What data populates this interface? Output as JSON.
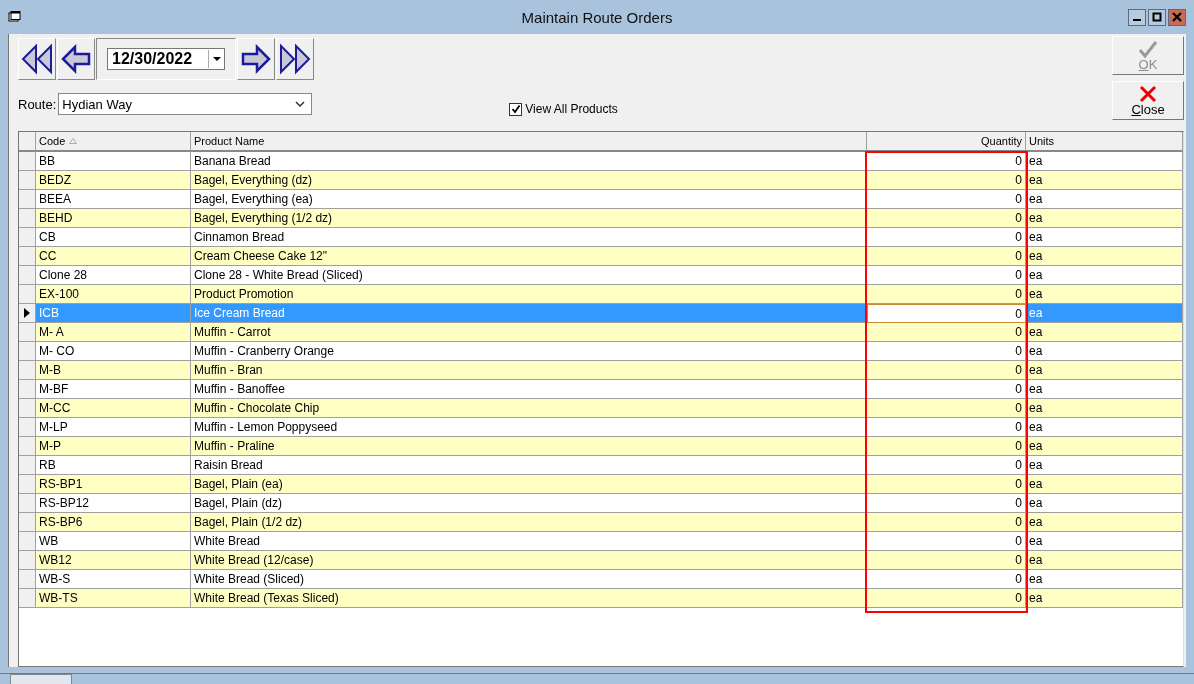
{
  "window": {
    "title": "Maintain Route Orders"
  },
  "date": {
    "value": "12/30/2022"
  },
  "route": {
    "label": "Route:",
    "value": "Hydian Way"
  },
  "view_all": {
    "label": "View All Products",
    "checked": true
  },
  "buttons": [
    {
      "kind": "ok",
      "label": "OK",
      "disabled": true
    },
    {
      "kind": "close",
      "label": "Close",
      "disabled": false
    }
  ],
  "table": {
    "columns": [
      {
        "label": "Code",
        "sorted": true
      },
      {
        "label": "Product Name",
        "sorted": false
      },
      {
        "label": "Quantity",
        "sorted": false
      },
      {
        "label": "Units",
        "sorted": false
      }
    ],
    "rows": [
      {
        "code": "BB",
        "name": "Banana Bread",
        "quantity": "0",
        "units": "ea",
        "selected": false
      },
      {
        "code": "BEDZ",
        "name": "Bagel, Everything (dz)",
        "quantity": "0",
        "units": "ea",
        "selected": false
      },
      {
        "code": "BEEA",
        "name": "Bagel, Everything (ea)",
        "quantity": "0",
        "units": "ea",
        "selected": false
      },
      {
        "code": "BEHD",
        "name": "Bagel, Everything (1/2 dz)",
        "quantity": "0",
        "units": "ea",
        "selected": false
      },
      {
        "code": "CB",
        "name": "Cinnamon Bread",
        "quantity": "0",
        "units": "ea",
        "selected": false
      },
      {
        "code": "CC",
        "name": "Cream Cheese Cake 12\"",
        "quantity": "0",
        "units": "ea",
        "selected": false
      },
      {
        "code": "Clone 28",
        "name": "Clone 28 - White Bread (Sliced)",
        "quantity": "0",
        "units": "ea",
        "selected": false
      },
      {
        "code": "EX-100",
        "name": "Product Promotion",
        "quantity": "0",
        "units": "ea",
        "selected": false
      },
      {
        "code": "ICB",
        "name": "Ice Cream Bread",
        "quantity": "0",
        "units": "ea",
        "selected": true
      },
      {
        "code": "M- A",
        "name": "Muffin - Carrot",
        "quantity": "0",
        "units": "ea",
        "selected": false
      },
      {
        "code": "M- CO",
        "name": "Muffin - Cranberry Orange",
        "quantity": "0",
        "units": "ea",
        "selected": false
      },
      {
        "code": "M-B",
        "name": "Muffin - Bran",
        "quantity": "0",
        "units": "ea",
        "selected": false
      },
      {
        "code": "M-BF",
        "name": "Muffin - Banoffee",
        "quantity": "0",
        "units": "ea",
        "selected": false
      },
      {
        "code": "M-CC",
        "name": "Muffin - Chocolate Chip",
        "quantity": "0",
        "units": "ea",
        "selected": false
      },
      {
        "code": "M-LP",
        "name": "Muffin - Lemon Poppyseed",
        "quantity": "0",
        "units": "ea",
        "selected": false
      },
      {
        "code": "M-P",
        "name": "Muffin - Praline",
        "quantity": "0",
        "units": "ea",
        "selected": false
      },
      {
        "code": "RB",
        "name": "Raisin Bread",
        "quantity": "0",
        "units": "ea",
        "selected": false
      },
      {
        "code": "RS-BP1",
        "name": "Bagel, Plain (ea)",
        "quantity": "0",
        "units": "ea",
        "selected": false
      },
      {
        "code": "RS-BP12",
        "name": "Bagel, Plain (dz)",
        "quantity": "0",
        "units": "ea",
        "selected": false
      },
      {
        "code": "RS-BP6",
        "name": "Bagel, Plain (1/2 dz)",
        "quantity": "0",
        "units": "ea",
        "selected": false
      },
      {
        "code": "WB",
        "name": "White Bread",
        "quantity": "0",
        "units": "ea",
        "selected": false
      },
      {
        "code": "WB12",
        "name": "White Bread (12/case)",
        "quantity": "0",
        "units": "ea",
        "selected": false
      },
      {
        "code": "WB-S",
        "name": "White Bread (Sliced)",
        "quantity": "0",
        "units": "ea",
        "selected": false
      },
      {
        "code": "WB-TS",
        "name": "White Bread (Texas Sliced)",
        "quantity": "0",
        "units": "ea",
        "selected": false
      }
    ]
  }
}
